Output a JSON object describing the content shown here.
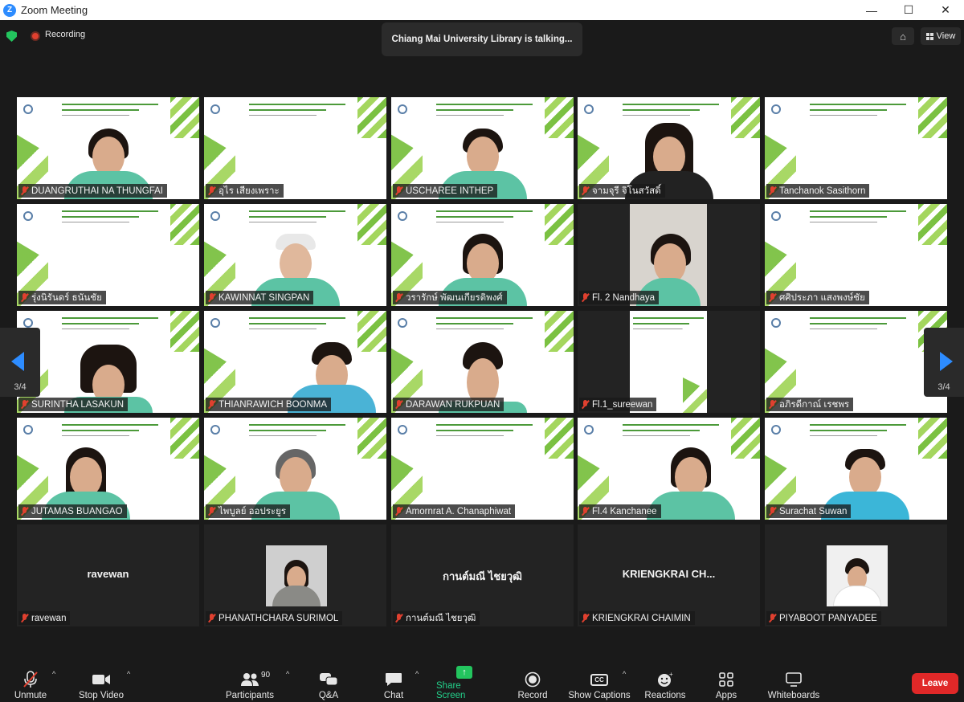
{
  "window": {
    "title": "Zoom Meeting",
    "logo_letter": "Z",
    "min": "—",
    "max": "☐",
    "close": "✕"
  },
  "topbar": {
    "recording_label": "Recording",
    "talking_banner": "Chiang Mai University Library is talking...",
    "view_label": "View"
  },
  "paging": {
    "left_label": "3/4",
    "right_label": "3/4"
  },
  "participants": [
    {
      "name": "DUANGRUTHAI NA THUNGFAI"
    },
    {
      "name": "อุไร เสียงเพราะ"
    },
    {
      "name": "USCHAREE INTHEP"
    },
    {
      "name": "จามจุรี จิโนสวัสดิ์"
    },
    {
      "name": "Tanchanok Sasithorn"
    },
    {
      "name": "รุ่งนิรันดร์ ธนันชัย"
    },
    {
      "name": "KAWINNAT SINGPAN"
    },
    {
      "name": "วรารักษ์ พัฒนเกียรติพงศ์"
    },
    {
      "name": "Fl. 2 Nandhaya"
    },
    {
      "name": "ศศิประภา แสงพงษ์ชัย"
    },
    {
      "name": "SURINTHA LASAKUN"
    },
    {
      "name": "THIANRAWICH BOONMA"
    },
    {
      "name": "DARAWAN RUKPUAN"
    },
    {
      "name": "Fl.1_sureewan"
    },
    {
      "name": "อภิรดีกาณ์ เรชพร"
    },
    {
      "name": "JUTAMAS BUANGAO"
    },
    {
      "name": "ไพบูลย์ ออประยูร"
    },
    {
      "name": "Amornrat A. Chanaphiwat"
    },
    {
      "name": "Fl.4 Kanchanee"
    },
    {
      "name": "Surachat Suwan"
    },
    {
      "name": "ravewan",
      "placeholder": "ravewan"
    },
    {
      "name": "PHANATHCHARA SURIMOL"
    },
    {
      "name": "กานต์มณี ไชยวุฒิ",
      "placeholder": "กานต์มณี ไชยวุฒิ"
    },
    {
      "name": "KRIENGKRAI CHAIMIN",
      "placeholder": "KRIENGKRAI  CH..."
    },
    {
      "name": "PIYABOOT PANYADEE"
    }
  ],
  "toolbar": {
    "unmute": "Unmute",
    "stop_video": "Stop Video",
    "participants": "Participants",
    "participant_count": "90",
    "qa": "Q&A",
    "chat": "Chat",
    "share_screen": "Share Screen",
    "record": "Record",
    "show_captions": "Show Captions",
    "cc": "CC",
    "reactions": "Reactions",
    "apps": "Apps",
    "whiteboards": "Whiteboards",
    "leave": "Leave"
  },
  "colors": {
    "zoom_blue": "#2D8CFF",
    "share_green": "#23c55e",
    "leave_red": "#e02828",
    "muted_red": "#e0402f",
    "slide_green": "#7bc142"
  }
}
